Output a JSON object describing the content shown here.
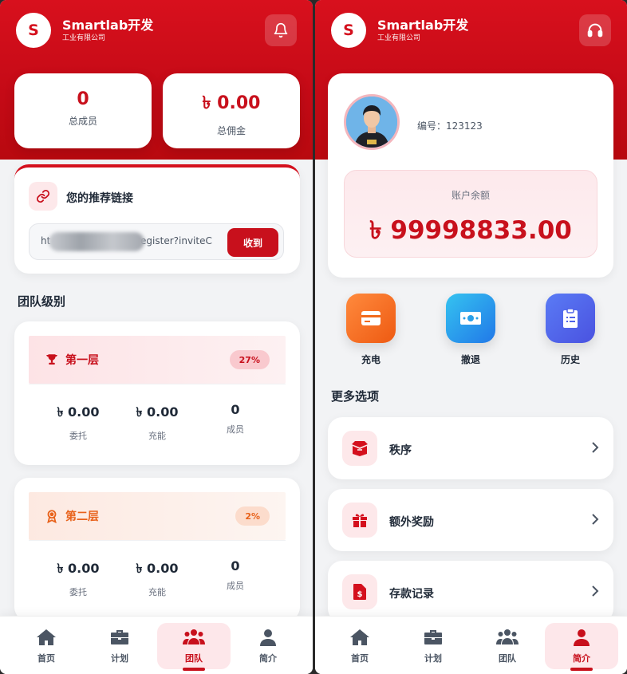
{
  "left": {
    "brand": {
      "logo_letter": "S",
      "name": "Smartlab开发",
      "subtitle": "工业有限公司"
    },
    "stats": [
      {
        "value": "0",
        "label": "总成员"
      },
      {
        "value": "৳ 0.00",
        "label": "总佣金"
      }
    ],
    "referral": {
      "title": "您的推荐链接",
      "url_prefix": "ht",
      "url_suffix": "/register?inviteC",
      "button": "收到"
    },
    "team_title": "团队级别",
    "levels": [
      {
        "name": "第一层",
        "percent": "27%",
        "icon": "trophy-icon",
        "stats": [
          {
            "value": "৳ 0.00",
            "label": "委托"
          },
          {
            "value": "৳ 0.00",
            "label": "充能"
          },
          {
            "value": "0",
            "label": "成员"
          }
        ]
      },
      {
        "name": "第二层",
        "percent": "2%",
        "icon": "medal-icon",
        "stats": [
          {
            "value": "৳ 0.00",
            "label": "委托"
          },
          {
            "value": "৳ 0.00",
            "label": "充能"
          },
          {
            "value": "0",
            "label": "成员"
          }
        ]
      }
    ],
    "tabs": [
      {
        "label": "首页",
        "icon": "home-icon"
      },
      {
        "label": "计划",
        "icon": "briefcase-icon"
      },
      {
        "label": "团队",
        "icon": "team-icon",
        "active": true
      },
      {
        "label": "简介",
        "icon": "user-icon"
      }
    ]
  },
  "right": {
    "brand": {
      "logo_letter": "S",
      "name": "Smartlab开发",
      "subtitle": "工业有限公司"
    },
    "profile": {
      "id_label": "编号：123123",
      "balance_label": "账户余额",
      "balance_value": "৳ 99998833.00"
    },
    "actions": [
      {
        "label": "充电",
        "icon": "card-icon",
        "color": "#f26a1b"
      },
      {
        "label": "撤退",
        "icon": "money-icon",
        "color": "#2aa0e8"
      },
      {
        "label": "历史",
        "icon": "clipboard-icon",
        "color": "#4f63e8"
      }
    ],
    "more_title": "更多选项",
    "menu": [
      {
        "label": "秩序",
        "icon": "box-icon"
      },
      {
        "label": "额外奖励",
        "icon": "gift-icon"
      },
      {
        "label": "存款记录",
        "icon": "deposit-file-icon"
      }
    ],
    "tabs": [
      {
        "label": "首页",
        "icon": "home-icon"
      },
      {
        "label": "计划",
        "icon": "briefcase-icon"
      },
      {
        "label": "团队",
        "icon": "team-icon"
      },
      {
        "label": "简介",
        "icon": "user-icon",
        "active": true
      }
    ]
  },
  "colors": {
    "primary": "#c8101c",
    "orange": "#e8621b",
    "bg": "#f2f3f5"
  }
}
